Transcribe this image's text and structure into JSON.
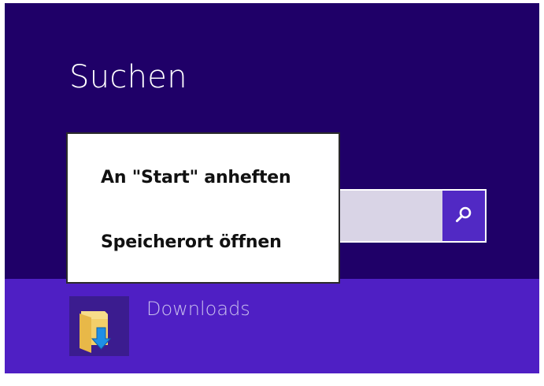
{
  "search": {
    "title": "Suchen",
    "input_value": "",
    "button_icon": "search-icon"
  },
  "results": [
    {
      "label": "Downloads",
      "icon": "folder-download-icon"
    }
  ],
  "context_menu": {
    "items": [
      {
        "label": "An \"Start\" anheften"
      },
      {
        "label": "Speicherort öffnen"
      }
    ]
  },
  "colors": {
    "background": "#1f0068",
    "selected_band": "#4f1fc4",
    "search_button": "#5129c4",
    "search_field": "#d9d4e6"
  }
}
